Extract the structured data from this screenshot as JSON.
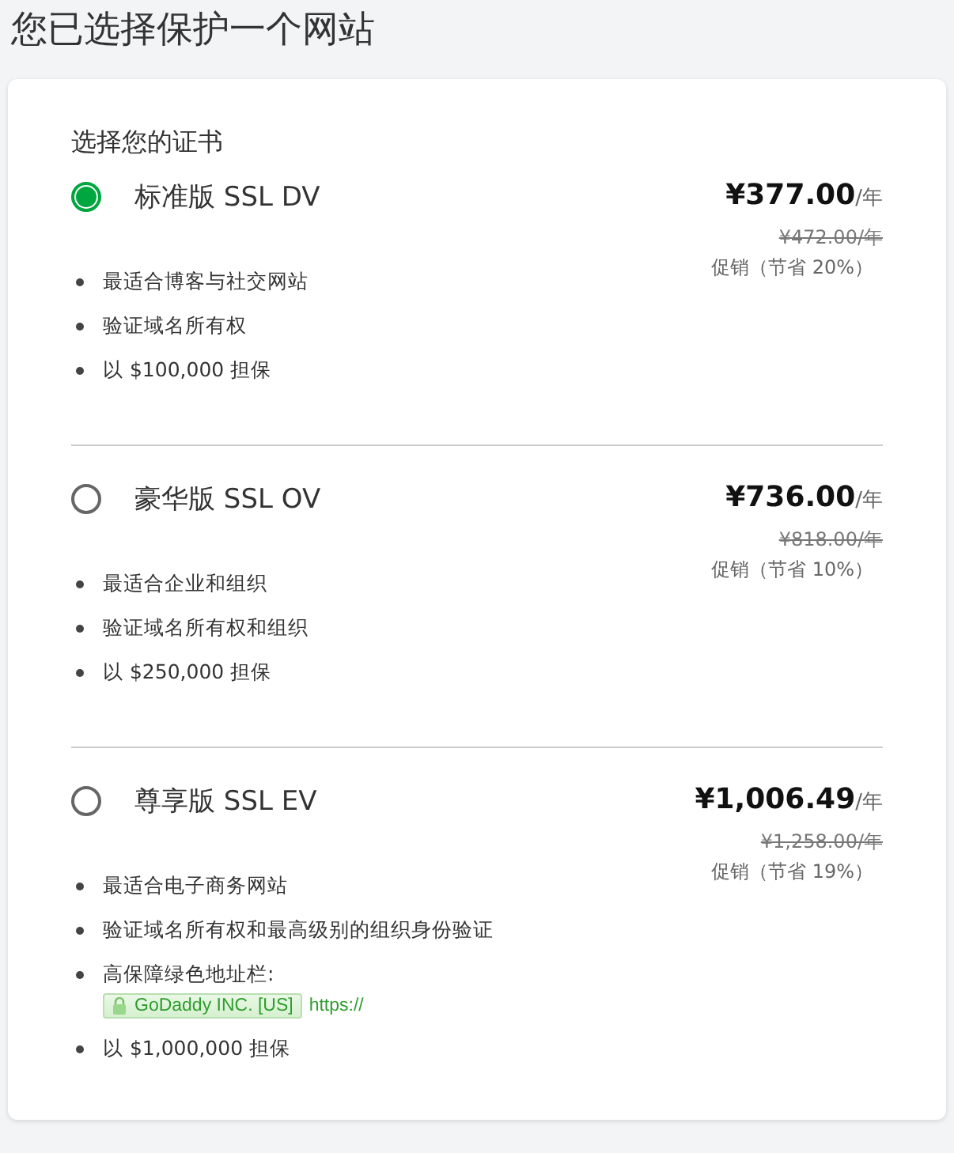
{
  "page_title": "您已选择保护一个网站",
  "heading": "选择您的证书",
  "plans": [
    {
      "name": "标准版 SSL DV",
      "selected": true,
      "price": "¥377.00",
      "unit": "/年",
      "old_price": "¥472.00/年",
      "promo": "促销（节省 20%）",
      "features": [
        {
          "kind": "text",
          "text": "最适合博客与社交网站"
        },
        {
          "kind": "text",
          "text": "验证域名所有权"
        },
        {
          "kind": "text",
          "text": "以 $100,000 担保"
        }
      ]
    },
    {
      "name": "豪华版 SSL OV",
      "selected": false,
      "price": "¥736.00",
      "unit": "/年",
      "old_price": "¥818.00/年",
      "promo": "促销（节省 10%）",
      "features": [
        {
          "kind": "text",
          "text": "最适合企业和组织"
        },
        {
          "kind": "text",
          "text": "验证域名所有权和组织"
        },
        {
          "kind": "text",
          "text": "以 $250,000 担保"
        }
      ]
    },
    {
      "name": "尊享版 SSL EV",
      "selected": false,
      "price": "¥1,006.49",
      "unit": "/年",
      "old_price": "¥1,258.00/年",
      "promo": "促销（节省 19%）",
      "features": [
        {
          "kind": "text",
          "text": "最适合电子商务网站"
        },
        {
          "kind": "text",
          "text": "验证域名所有权和最高级别的组织身份验证"
        },
        {
          "kind": "address_bar",
          "text": "高保障绿色地址栏:",
          "company": "GoDaddy INC. [US]",
          "url": "https://"
        },
        {
          "kind": "text",
          "text": "以 $1,000,000 担保"
        }
      ]
    }
  ]
}
